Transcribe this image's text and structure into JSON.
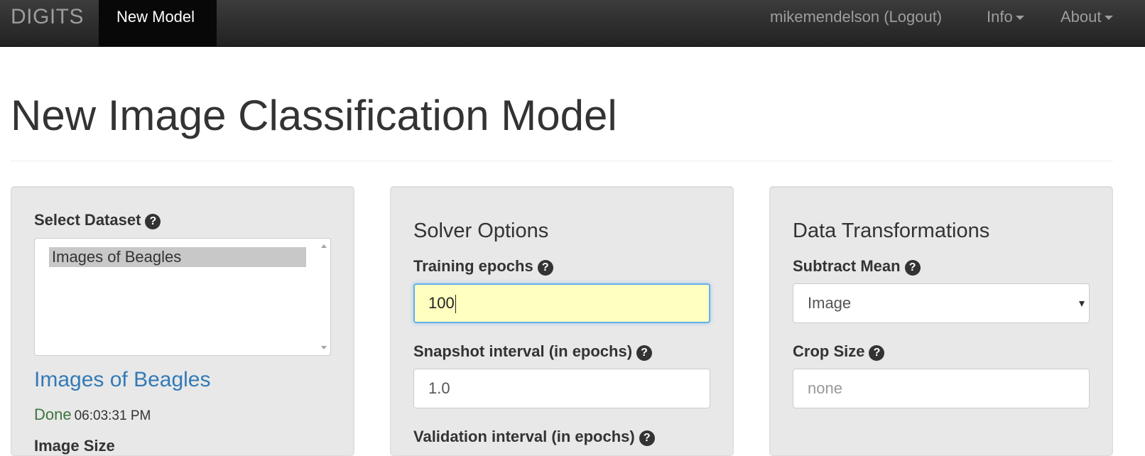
{
  "navbar": {
    "brand": "DIGITS",
    "active_tab": "New Model",
    "user_link": "mikemendelson (Logout)",
    "info_menu": "Info",
    "about_menu": "About"
  },
  "page": {
    "title": "New Image Classification Model"
  },
  "dataset_panel": {
    "select_label": "Select Dataset",
    "options": [
      "Images of Beagles"
    ],
    "selected_dataset_link": "Images of Beagles",
    "status": "Done",
    "status_time": "06:03:31 PM",
    "next_label": "Image Size"
  },
  "solver_panel": {
    "legend": "Solver Options",
    "training_epochs_label": "Training epochs",
    "training_epochs_value": "100",
    "snapshot_label": "Snapshot interval (in epochs)",
    "snapshot_value": "1.0",
    "validation_label": "Validation interval (in epochs)"
  },
  "transform_panel": {
    "legend": "Data Transformations",
    "subtract_mean_label": "Subtract Mean",
    "subtract_mean_value": "Image",
    "crop_size_label": "Crop Size",
    "crop_size_placeholder": "none"
  },
  "icons": {
    "help": "question-circle-icon",
    "caret": "caret-down-icon"
  },
  "colors": {
    "navbar_bg": "#222222",
    "link_blue": "#337ab7",
    "done_green": "#3c763d",
    "focus_field_bg": "#ffffc0",
    "focus_border": "#66afe9"
  }
}
